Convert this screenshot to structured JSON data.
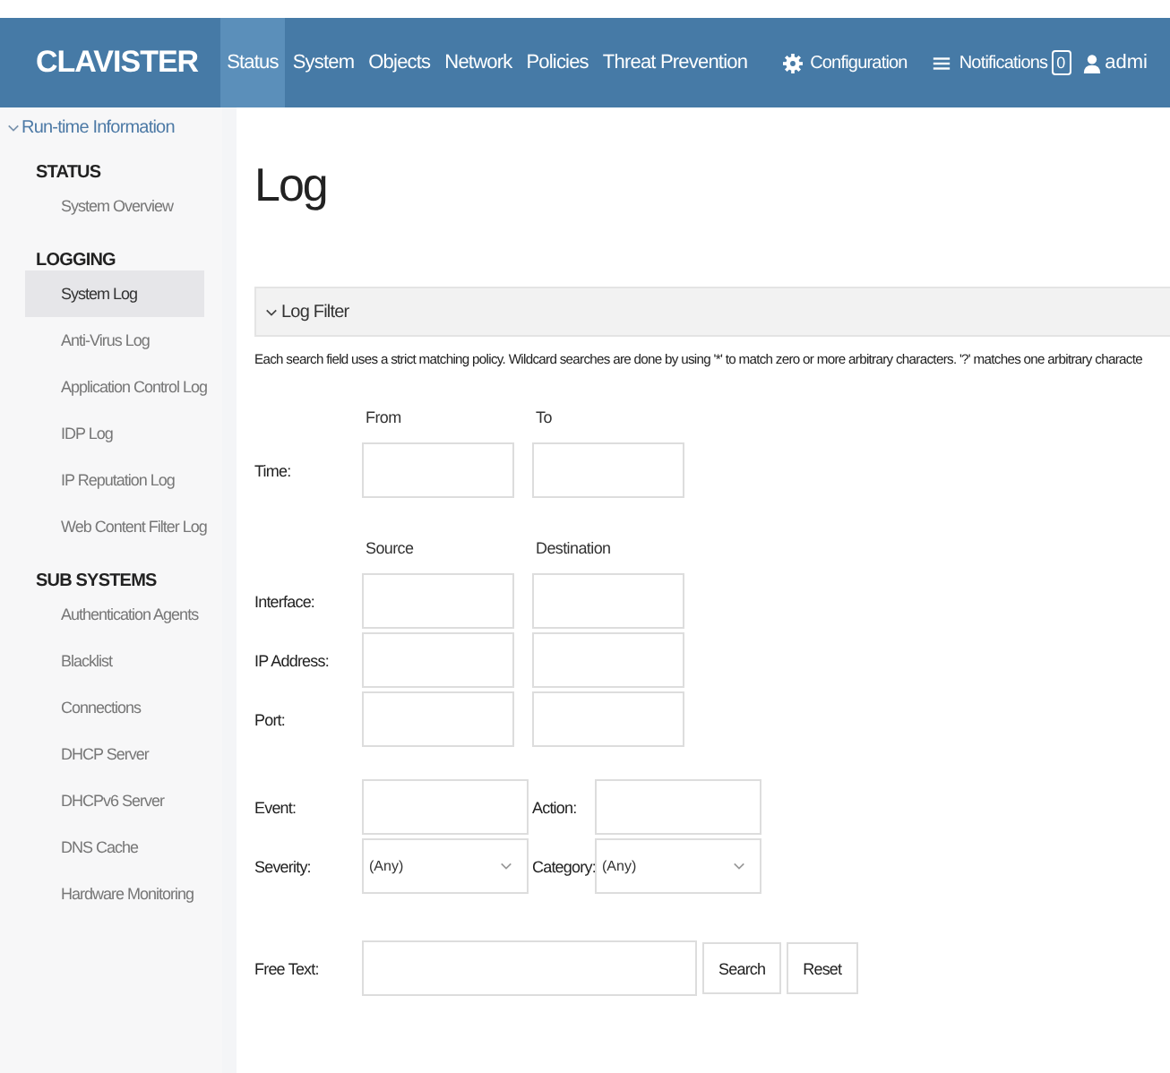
{
  "brand": "CLAVISTER",
  "nav": [
    {
      "label": "Status",
      "selected": true
    },
    {
      "label": "System",
      "selected": false
    },
    {
      "label": "Objects",
      "selected": false
    },
    {
      "label": "Network",
      "selected": false
    },
    {
      "label": "Policies",
      "selected": false
    },
    {
      "label": "Threat Prevention",
      "selected": false
    }
  ],
  "configuration": "Configuration",
  "notifications": {
    "label": "Notifications",
    "count": "0"
  },
  "user": "admi",
  "sidebar": {
    "title": "Run-time Information",
    "expanded": true,
    "sections": [
      {
        "heading": "STATUS",
        "items": [
          {
            "label": "System Overview",
            "selected": false
          }
        ]
      },
      {
        "heading": "LOGGING",
        "items": [
          {
            "label": "System Log",
            "selected": true
          },
          {
            "label": "Anti-Virus Log",
            "selected": false
          },
          {
            "label": "Application Control Log",
            "selected": false
          },
          {
            "label": "IDP Log",
            "selected": false
          },
          {
            "label": "IP Reputation Log",
            "selected": false
          },
          {
            "label": "Web Content Filter Log",
            "selected": false
          }
        ]
      },
      {
        "heading": "SUB SYSTEMS",
        "items": [
          {
            "label": "Authentication Agents",
            "selected": false
          },
          {
            "label": "Blacklist",
            "selected": false
          },
          {
            "label": "Connections",
            "selected": false
          },
          {
            "label": "DHCP Server",
            "selected": false
          },
          {
            "label": "DHCPv6 Server",
            "selected": false
          },
          {
            "label": "DNS Cache",
            "selected": false
          },
          {
            "label": "Hardware Monitoring",
            "selected": false
          }
        ]
      }
    ]
  },
  "page_title": "Log",
  "filter": {
    "title": "Log Filter",
    "expanded": true,
    "hint": "Each search field uses a strict matching policy. Wildcard searches are done by using '*' to match zero or more arbitrary characters. '?' matches one arbitrary characte",
    "time": {
      "label": "Time:",
      "from": "From",
      "to": "To"
    },
    "pair_headers": {
      "source": "Source",
      "destination": "Destination"
    },
    "pair_rows": [
      "Interface:",
      "IP Address:",
      "Port:"
    ],
    "event": "Event:",
    "action": "Action:",
    "severity": {
      "label": "Severity:",
      "value": "(Any)"
    },
    "category": {
      "label": "Category:",
      "value": "(Any)"
    },
    "free_text": "Free Text:",
    "buttons": [
      "Search",
      "Reset"
    ]
  }
}
